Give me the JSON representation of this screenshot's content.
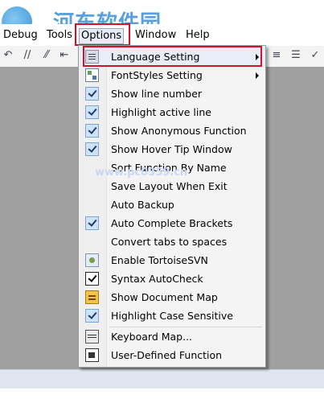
{
  "watermark": {
    "site_text": "河东软件园",
    "url_text": "www.pc0359.cn"
  },
  "menubar": [
    {
      "label": "Debug"
    },
    {
      "label": "Tools"
    },
    {
      "label": "Options"
    },
    {
      "label": "Window"
    },
    {
      "label": "Help"
    }
  ],
  "toolbar_icons": [
    "undo-icon",
    "comment-icon",
    "uncomment-icon",
    "indent-icon",
    "outdent-icon",
    "align-icon",
    "check-icon"
  ],
  "options_menu": {
    "items": [
      {
        "label": "Language Setting",
        "icon": "language-icon",
        "submenu": true,
        "selected": true
      },
      {
        "label": "FontStyles Setting",
        "icon": "font-styles-icon",
        "submenu": true
      },
      {
        "label": "Show line number",
        "checked": true
      },
      {
        "label": "Highlight active line",
        "checked": true
      },
      {
        "label": "Show Anonymous Function",
        "checked": true
      },
      {
        "label": "Show Hover Tip Window",
        "checked": true
      },
      {
        "label": "Sort Function By Name",
        "checked": false
      },
      {
        "label": "Save Layout When Exit",
        "checked": false
      },
      {
        "label": "Auto Backup",
        "checked": false
      },
      {
        "label": "Auto Complete Brackets",
        "checked": true
      },
      {
        "label": "Convert tabs to spaces",
        "checked": false
      },
      {
        "label": "Enable TortoiseSVN",
        "icon": "tortoise-svn-icon"
      },
      {
        "label": "Syntax AutoCheck",
        "icon": "syntax-check-icon"
      },
      {
        "label": "Show Document Map",
        "icon": "document-map-icon"
      },
      {
        "label": "Highlight Case Sensitive",
        "checked": true
      },
      {
        "label": "Keyboard Map...",
        "icon": "keyboard-icon"
      },
      {
        "label": "User-Defined Function",
        "icon": "function-icon"
      }
    ]
  },
  "colors": {
    "highlight_border": "#d4102a",
    "menu_bg": "#f4f4f4",
    "check_bg": "#cfe3f7"
  }
}
